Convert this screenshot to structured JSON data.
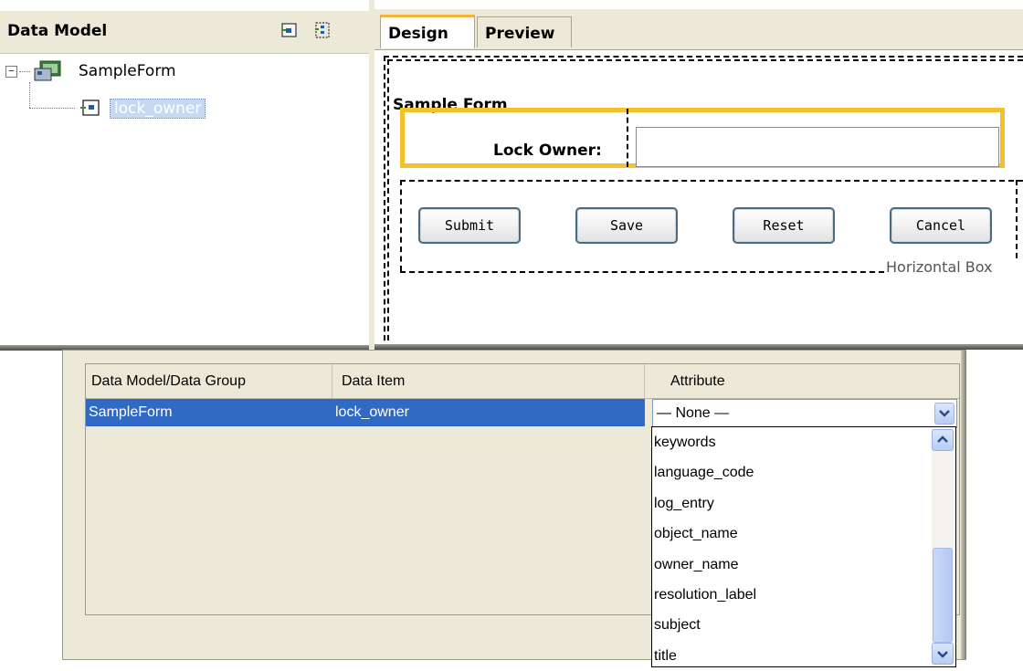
{
  "data_model": {
    "title": "Data Model",
    "tree": {
      "root": "SampleForm",
      "child": "lock_owner"
    }
  },
  "design": {
    "tabs": [
      "Design",
      "Preview"
    ],
    "active_tab": "Design",
    "form_title": "Sample Form",
    "field_label": "Lock Owner:",
    "field_value": "",
    "buttons": [
      "Submit",
      "Save",
      "Reset",
      "Cancel"
    ],
    "hbox_label": "Horizontal Box"
  },
  "mapping": {
    "columns": [
      "Data Model/Data Group",
      "Data Item",
      "Attribute"
    ],
    "row": {
      "group": "SampleForm",
      "item": "lock_owner",
      "attribute": "— None —"
    },
    "attribute_options": [
      "keywords",
      "language_code",
      "log_entry",
      "object_name",
      "owner_name",
      "resolution_label",
      "subject",
      "title"
    ]
  },
  "colors": {
    "selection_blue": "#316ac5",
    "active_tab_accent": "#f0b43c",
    "selected_field_border": "#f2c12b"
  }
}
